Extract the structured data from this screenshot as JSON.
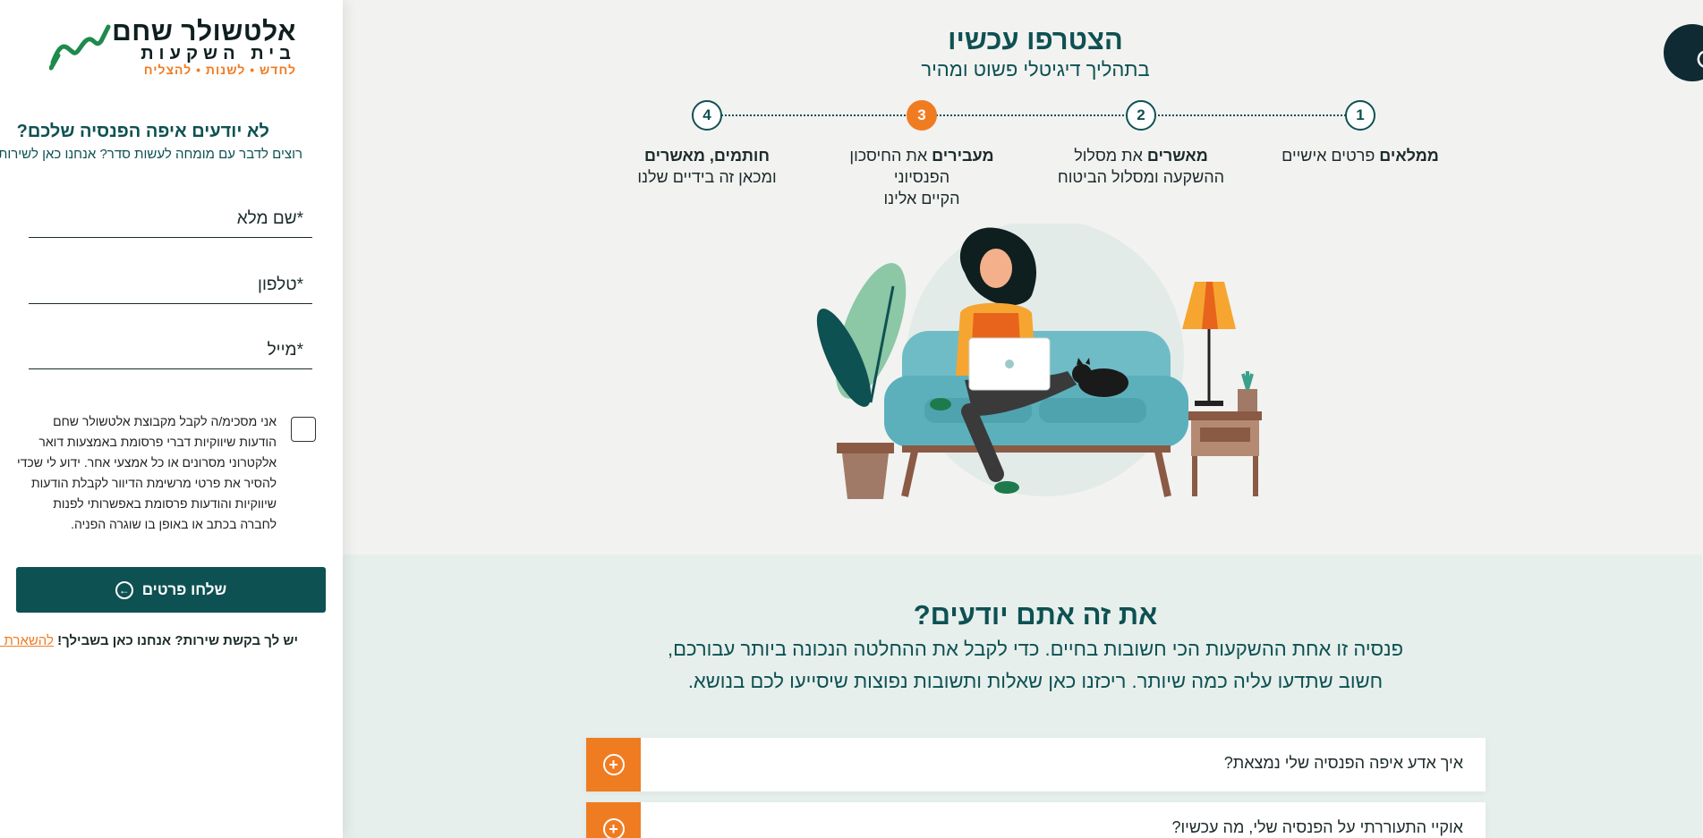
{
  "brand": {
    "name": "אלטשולר שחם",
    "sub": "בית השקעות",
    "tagline": "לחדש • לשנות • להצליח"
  },
  "sidebar": {
    "title": "לא יודעים איפה הפנסיה שלכם?",
    "subtitle": "רוצים לדבר עם מומחה לעשות סדר? אנחנו כאן לשירותכם!",
    "fields": {
      "name": "*שם מלא",
      "phone": "*טלפון",
      "email": "*מייל"
    },
    "consent": "אני מסכימ/ה לקבל מקבוצת אלטשולר שחם הודעות שיווקיות דברי פרסומת באמצעות דואר אלקטרוני מסרונים או כל אמצעי אחר. ידוע לי שכדי להסיר את פרטי מרשימת הדיוור לקבלת הודעות שיווקיות והודעות פרסומת באפשרותי לפנות לחברה בכתב או באופן בו שוגרה הפניה.",
    "submit": "שלחו פרטים",
    "help_text": "יש לך בקשת שירות? אנחנו כאן בשבילך!",
    "help_link": "להשארת פנייה"
  },
  "hero": {
    "title": "הצטרפו עכשיו",
    "subtitle": "בתהליך דיגיטלי פשוט ומהיר",
    "steps": [
      {
        "num": "1",
        "bold": "ממלאים",
        "rest": " פרטים אישיים",
        "line2": ""
      },
      {
        "num": "2",
        "bold": "מאשרים",
        "rest": " את מסלול",
        "line2": "ההשקעה ומסלול הביטוח"
      },
      {
        "num": "3",
        "bold": "מעבירים",
        "rest": " את החיסכון הפנסיוני",
        "line2": "הקיים אלינו"
      },
      {
        "num": "4",
        "bold": "חותמים, מאשרים",
        "rest": "",
        "line2": "ומכאן זה בידיים שלנו"
      }
    ]
  },
  "faq": {
    "title": "את זה אתם יודעים?",
    "desc_line1": "פנסיה זו אחת ההשקעות הכי חשובות בחיים. כדי לקבל את ההחלטה הנכונה ביותר עבורכם,",
    "desc_line2": "חשוב שתדעו עליה כמה שיותר. ריכזנו כאן שאלות ותשובות נפוצות שיסייעו לכם בנושא.",
    "items": [
      "איך אדע איפה הפנסיה שלי נמצאת?",
      "אוקיי התעוררתי על הפנסיה שלי, מה עכשיו?"
    ]
  },
  "icons": [
    "logo-mark-icon",
    "arrow-left-circle-icon",
    "plus-circle-icon",
    "accessibility-icon"
  ],
  "colors": {
    "primary": "#0e5152",
    "accent": "#f07c22",
    "hero_bg": "#f2f2f1",
    "faq_bg": "#e6efec"
  }
}
